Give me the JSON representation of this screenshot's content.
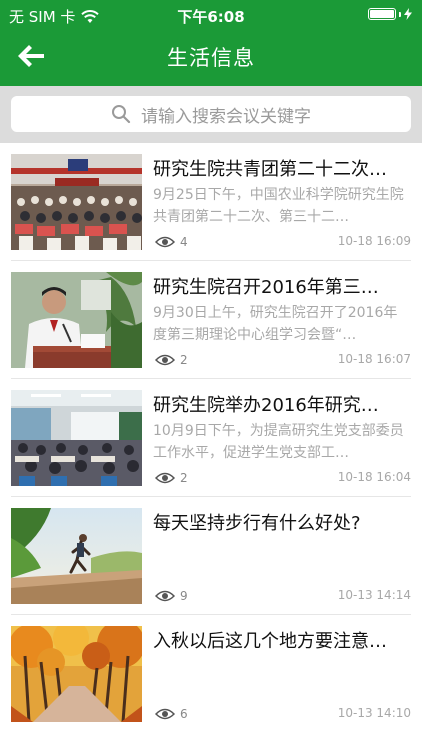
{
  "status_bar": {
    "carrier": "无 SIM 卡",
    "time": "下午6:08",
    "battery_level": 1.0
  },
  "header": {
    "title": "生活信息",
    "back_icon": "back-arrow-icon"
  },
  "search": {
    "placeholder": "请输入搜索会议关键字"
  },
  "news": [
    {
      "title": "研究生院共青团第二十二次…",
      "summary": "9月25日下午，中国农业科学院研究生院共青团第二十二次、第三十二…",
      "views": "4",
      "date": "10-18 16:09",
      "image": "auditorium-meeting"
    },
    {
      "title": "研究生院召开2016年第三…",
      "summary": "9月30日上午，研究生院召开了2016年度第三期理论中心组学习会暨“…",
      "views": "2",
      "date": "10-18 16:07",
      "image": "speaker-at-podium"
    },
    {
      "title": "研究生院举办2016年研究…",
      "summary": "10月9日下午，为提高研究生党支部委员工作水平，促进学生党支部工…",
      "views": "2",
      "date": "10-18 16:04",
      "image": "classroom-lecture"
    },
    {
      "title": "每天坚持步行有什么好处?",
      "summary": "",
      "views": "9",
      "date": "10-13 14:14",
      "image": "runner-on-road"
    },
    {
      "title": "入秋以后这几个地方要注意…",
      "summary": "",
      "views": "6",
      "date": "10-13 14:10",
      "image": "autumn-tree-path"
    }
  ],
  "colors": {
    "brand_green": "#1b9a37",
    "search_bg": "#dcdcdc"
  }
}
